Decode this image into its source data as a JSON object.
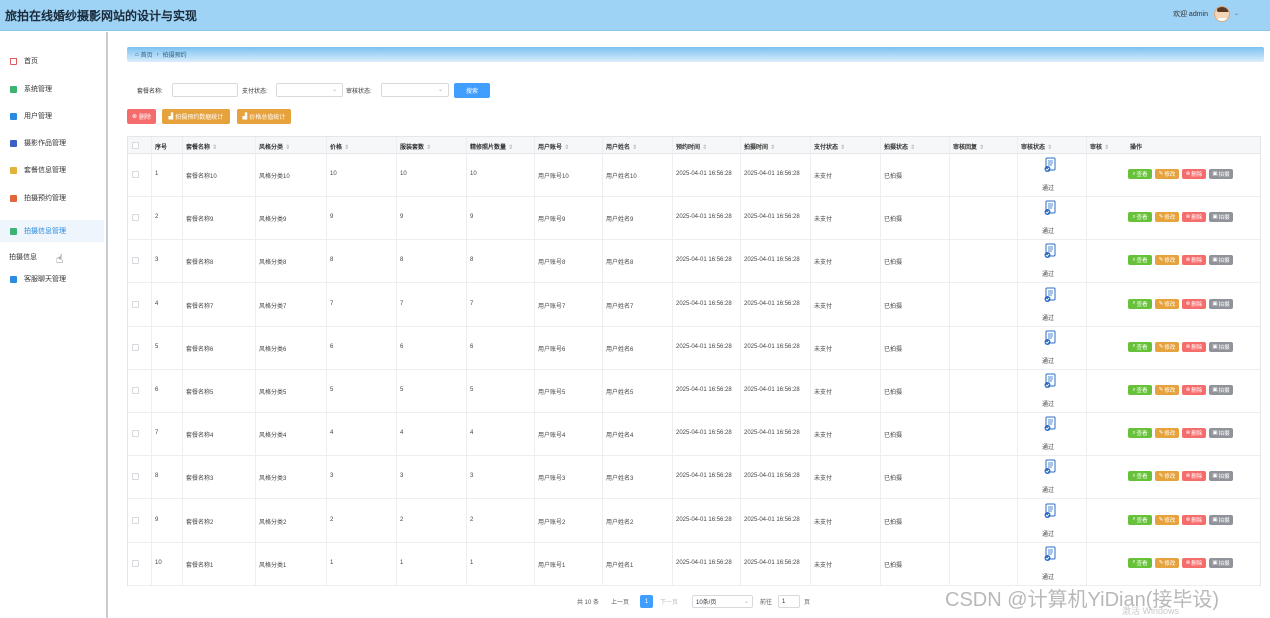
{
  "header": {
    "title": "旅拍在线婚纱摄影网站的设计与实现",
    "user": "欢迎 admin"
  },
  "sidebar": {
    "items": [
      {
        "label": "首页",
        "icon": "home-icon",
        "color": "#e05b5b"
      },
      {
        "label": "系统管理",
        "icon": "stack-icon",
        "color": "#3cb371"
      },
      {
        "label": "用户管理",
        "icon": "grid-icon",
        "color": "#2b8be0"
      },
      {
        "label": "摄影作品管理",
        "icon": "picture-icon",
        "color": "#3a5fc7"
      },
      {
        "label": "套餐信息管理",
        "icon": "package-icon",
        "color": "#e3b23c"
      },
      {
        "label": "拍摄预约管理",
        "icon": "calendar-icon",
        "color": "#e0663c"
      },
      {
        "label": "拍摄信息管理",
        "icon": "apps-icon",
        "color": "#3cb371"
      },
      {
        "label": "拍摄信息",
        "icon": "",
        "color": ""
      },
      {
        "label": "客服聊天管理",
        "icon": "chat-icon",
        "color": "#2b8be0"
      }
    ]
  },
  "breadcrumb": {
    "home": "首页",
    "current": "拍摄预约"
  },
  "search": {
    "package_label": "套餐名称:",
    "pay_label": "支付状态:",
    "review_label": "审核状态:",
    "search_button": "搜索"
  },
  "actions": {
    "delete": "删除",
    "stats_count": "拍摄预约数据统计",
    "stats_amount": "价格总值统计"
  },
  "table": {
    "headers": [
      "序号",
      "套餐名称",
      "风格分类",
      "价格",
      "服装套数",
      "精修照片数量",
      "用户账号",
      "用户姓名",
      "预约时间",
      "拍摄时间",
      "支付状态",
      "拍摄状态",
      "审核回复",
      "审核状态",
      "审核",
      "操作"
    ],
    "rows": [
      {
        "no": "1",
        "name": "套餐名称10",
        "style": "风格分类10",
        "price": "10",
        "suits": "10",
        "photos": "10",
        "account": "用户账号10",
        "uname": "用户姓名10",
        "book": "2025-04-01 16:56:28",
        "shoot": "2025-04-01 16:56:28",
        "pay": "未支付",
        "status": "已拍摄",
        "review": "通过"
      },
      {
        "no": "2",
        "name": "套餐名称9",
        "style": "风格分类9",
        "price": "9",
        "suits": "9",
        "photos": "9",
        "account": "用户账号9",
        "uname": "用户姓名9",
        "book": "2025-04-01 16:56:28",
        "shoot": "2025-04-01 16:56:28",
        "pay": "未支付",
        "status": "已拍摄",
        "review": "通过"
      },
      {
        "no": "3",
        "name": "套餐名称8",
        "style": "风格分类8",
        "price": "8",
        "suits": "8",
        "photos": "8",
        "account": "用户账号8",
        "uname": "用户姓名8",
        "book": "2025-04-01 16:56:28",
        "shoot": "2025-04-01 16:56:28",
        "pay": "未支付",
        "status": "已拍摄",
        "review": "通过"
      },
      {
        "no": "4",
        "name": "套餐名称7",
        "style": "风格分类7",
        "price": "7",
        "suits": "7",
        "photos": "7",
        "account": "用户账号7",
        "uname": "用户姓名7",
        "book": "2025-04-01 16:56:28",
        "shoot": "2025-04-01 16:56:28",
        "pay": "未支付",
        "status": "已拍摄",
        "review": "通过"
      },
      {
        "no": "5",
        "name": "套餐名称6",
        "style": "风格分类6",
        "price": "6",
        "suits": "6",
        "photos": "6",
        "account": "用户账号6",
        "uname": "用户姓名6",
        "book": "2025-04-01 16:56:28",
        "shoot": "2025-04-01 16:56:28",
        "pay": "未支付",
        "status": "已拍摄",
        "review": "通过"
      },
      {
        "no": "6",
        "name": "套餐名称5",
        "style": "风格分类5",
        "price": "5",
        "suits": "5",
        "photos": "5",
        "account": "用户账号5",
        "uname": "用户姓名5",
        "book": "2025-04-01 16:56:28",
        "shoot": "2025-04-01 16:56:28",
        "pay": "未支付",
        "status": "已拍摄",
        "review": "通过"
      },
      {
        "no": "7",
        "name": "套餐名称4",
        "style": "风格分类4",
        "price": "4",
        "suits": "4",
        "photos": "4",
        "account": "用户账号4",
        "uname": "用户姓名4",
        "book": "2025-04-01 16:56:28",
        "shoot": "2025-04-01 16:56:28",
        "pay": "未支付",
        "status": "已拍摄",
        "review": "通过"
      },
      {
        "no": "8",
        "name": "套餐名称3",
        "style": "风格分类3",
        "price": "3",
        "suits": "3",
        "photos": "3",
        "account": "用户账号3",
        "uname": "用户姓名3",
        "book": "2025-04-01 16:56:28",
        "shoot": "2025-04-01 16:56:28",
        "pay": "未支付",
        "status": "已拍摄",
        "review": "通过"
      },
      {
        "no": "9",
        "name": "套餐名称2",
        "style": "风格分类2",
        "price": "2",
        "suits": "2",
        "photos": "2",
        "account": "用户账号2",
        "uname": "用户姓名2",
        "book": "2025-04-01 16:56:28",
        "shoot": "2025-04-01 16:56:28",
        "pay": "未支付",
        "status": "已拍摄",
        "review": "通过"
      },
      {
        "no": "10",
        "name": "套餐名称1",
        "style": "风格分类1",
        "price": "1",
        "suits": "1",
        "photos": "1",
        "account": "用户账号1",
        "uname": "用户姓名1",
        "book": "2025-04-01 16:56:28",
        "shoot": "2025-04-01 16:56:28",
        "pay": "未支付",
        "status": "已拍摄",
        "review": "通过"
      }
    ],
    "row_actions": {
      "view": "查看",
      "edit": "修改",
      "delete": "删除",
      "shoot": "拍摄"
    }
  },
  "pagination": {
    "total": "共 10 条",
    "prev": "上一页",
    "page": "1",
    "next": "下一页",
    "page_size": "10条/页",
    "goto": "前往",
    "goto_value": "1",
    "page_unit": "页"
  },
  "watermark": "CSDN @计算机YiDian(接毕设)",
  "activation": "激活 Windows",
  "colors": {
    "primary": "#409eff",
    "danger": "#f56c6c",
    "warning": "#e6a23c",
    "success": "#67c23a",
    "info": "#909399",
    "header_bg": "#9fd3f5"
  }
}
